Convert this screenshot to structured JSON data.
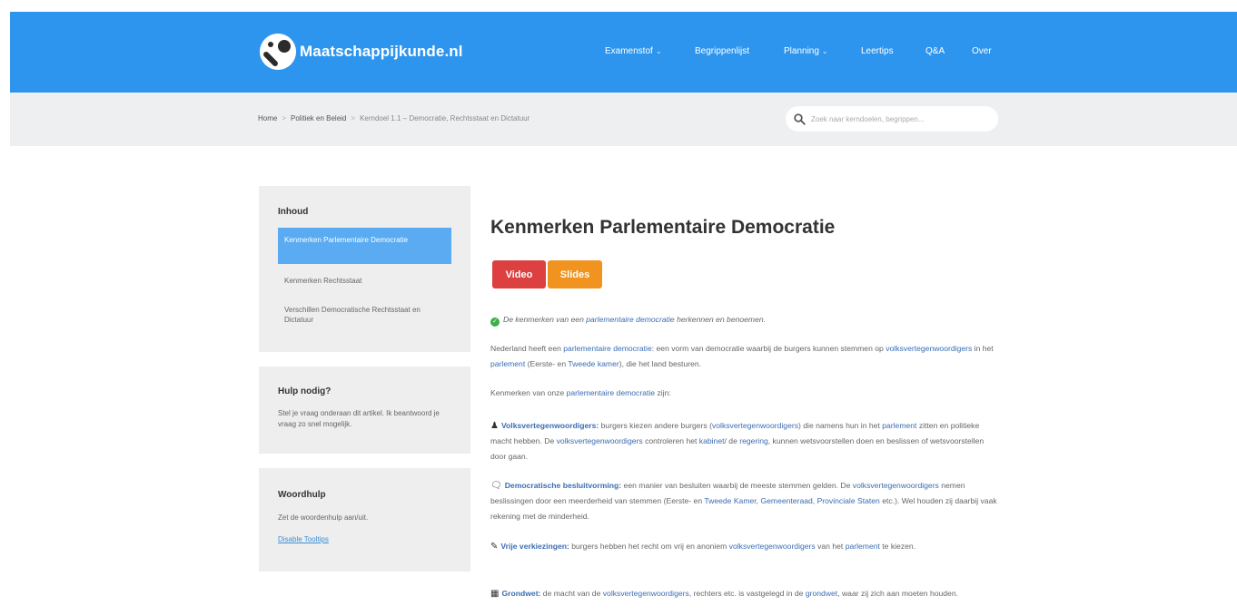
{
  "header": {
    "logo_text": "Maatschappijkunde.nl",
    "nav": [
      {
        "label": "Examenstof",
        "has_dropdown": true
      },
      {
        "label": "Begrippenlijst",
        "has_dropdown": false
      },
      {
        "label": "Planning",
        "has_dropdown": true
      },
      {
        "label": "Leertips",
        "has_dropdown": false
      },
      {
        "label": "Q&A",
        "has_dropdown": false
      },
      {
        "label": "Over",
        "has_dropdown": false
      }
    ],
    "colors": {
      "header_bg": "#2d95ee",
      "crumb_bg": "#eeeff1"
    }
  },
  "breadcrumb": {
    "items": [
      "Home",
      "Politiek en Beleid"
    ],
    "separator": ">",
    "current": "Kerndoel 1.1 – Democratie, Rechtsstaat en Dictatuur"
  },
  "search": {
    "placeholder": "Zoek naar kerndoelen, begrippen..."
  },
  "sidebar": {
    "toc_title": "Inhoud",
    "toc_items": [
      {
        "label": "Kenmerken Parlementaire Democratie",
        "active": true
      },
      {
        "label": "Kenmerken Rechtsstaat",
        "active": false
      },
      {
        "label": "Verschillen Democratische Rechtsstaat en Dictatuur",
        "active": false
      }
    ],
    "help_title": "Hulp nodig?",
    "help_text": "Stel je vraag onderaan dit artikel. Ik beantwoord je vraag zo snel mogelijk.",
    "words_title": "Woordhulp",
    "words_text": "Zet de woordenhulp aan/uit.",
    "words_link": "Disable Tooltips"
  },
  "main": {
    "title": "Kenmerken Parlementaire Democratie",
    "buttons": {
      "video": "Video",
      "slides": "Slides"
    },
    "button_colors": {
      "video": "#dc4040",
      "slides": "#f0941f"
    },
    "goal": {
      "pre": "De kenmerken van een ",
      "link": "parlementaire democratie",
      "post": " herkennen en benoemen."
    },
    "p1": {
      "a": "Nederland heeft een ",
      "l1": "parlementaire democratie",
      "b": ": een vorm van democratie waarbij de burgers kunnen stemmen op ",
      "l2": "volksvertegenwoordigers",
      "c": " in het ",
      "l3": "parlement",
      "d": " (Eerste- en ",
      "l4": "Tweede kamer",
      "e": "), die het land besturen."
    },
    "p2": {
      "a": "Kenmerken van onze ",
      "l1": "parlementaire democratie",
      "b": " zijn:"
    },
    "items": [
      {
        "icon": "person-podium-icon",
        "term": "Volksvertegenwoordigers:",
        "a": " burgers kiezen andere burgers (",
        "l1": "volksvertegenwoordigers",
        "b": ") die namens hun in het ",
        "l2": "parlement",
        "c": " zitten en politieke macht hebben. De ",
        "l3": "volksvertegenwoordigers",
        "d": " controleren het ",
        "l4": "kabinet",
        "e": "/ de ",
        "l5": "regering",
        "f": ", kunnen wetsvoorstellen doen en beslissen of wetsvoorstellen door gaan."
      },
      {
        "icon": "speech-bubbles-icon",
        "term": "Democratische besluitvorming:",
        "a": " een manier van besluiten waarbij de meeste stemmen gelden. De ",
        "l1": "volksvertegenwoordigers",
        "b": " nemen beslissingen door een meerderheid van stemmen (Eerste- en ",
        "l2": "Tweede Kamer",
        "c": ", ",
        "l3": "Gemeenteraad",
        "d": ", ",
        "l4": "Provinciale Staten",
        "e": " etc.). Wel houden zij daarbij vaak rekening met de minderheid."
      },
      {
        "icon": "pencil-square-icon",
        "term": "Vrije verkiezingen:",
        "a": " burgers hebben het recht om vrij en anoniem ",
        "l1": "volksvertegenwoordigers",
        "b": " van het ",
        "l2": "parlement",
        "c": " te kiezen."
      },
      {
        "icon": "book-icon",
        "term": "Grondwet:",
        "a": " de macht van de ",
        "l1": "volksvertegenwoordigers",
        "b": ", rechters etc. is vastgelegd in de ",
        "l2": "grondwet",
        "c": ", waar zij zich aan moeten houden."
      }
    ]
  }
}
